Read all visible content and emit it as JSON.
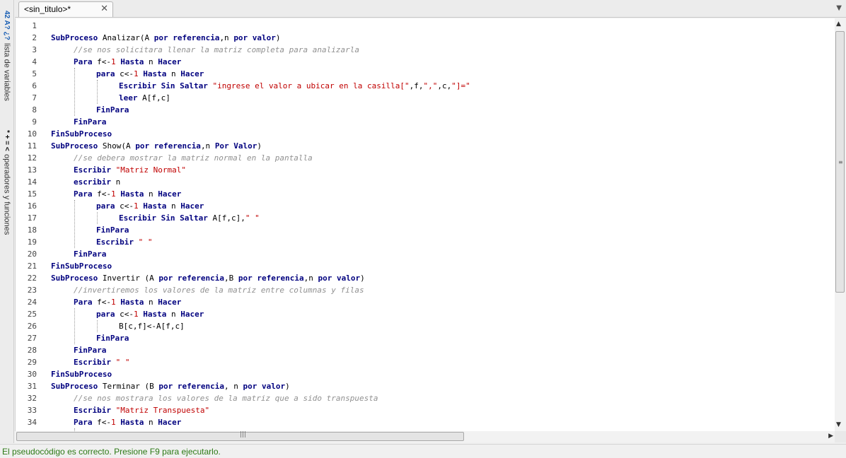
{
  "side_panel": {
    "variables_icon": "42 A? ¿?",
    "variables_label": "lista de variables",
    "operators_icon": "* + = <",
    "operators_label": "operadores y funciones"
  },
  "tabs": [
    {
      "label": "<sin_titulo>*"
    }
  ],
  "editor": {
    "lines": [
      {
        "n": "1",
        "indent": 0,
        "tokens": []
      },
      {
        "n": "2",
        "indent": 0,
        "tokens": [
          [
            "kw",
            "SubProceso"
          ],
          [
            "t",
            " Analizar(A "
          ],
          [
            "kw",
            "por referencia"
          ],
          [
            "t",
            ",n "
          ],
          [
            "kw",
            "por valor"
          ],
          [
            "t",
            ")"
          ]
        ]
      },
      {
        "n": "3",
        "indent": 1,
        "tokens": [
          [
            "cm",
            "//se nos solicitara llenar la matriz completa para analizarla"
          ]
        ]
      },
      {
        "n": "4",
        "indent": 1,
        "tokens": [
          [
            "kw",
            "Para"
          ],
          [
            "t",
            " f<-"
          ],
          [
            "num",
            "1"
          ],
          [
            "t",
            " "
          ],
          [
            "kw",
            "Hasta"
          ],
          [
            "t",
            " n "
          ],
          [
            "kw",
            "Hacer"
          ]
        ]
      },
      {
        "n": "5",
        "indent": 2,
        "tokens": [
          [
            "kw",
            "para"
          ],
          [
            "t",
            " c<-"
          ],
          [
            "num",
            "1"
          ],
          [
            "t",
            " "
          ],
          [
            "kw",
            "Hasta"
          ],
          [
            "t",
            " n "
          ],
          [
            "kw",
            "Hacer"
          ]
        ]
      },
      {
        "n": "6",
        "indent": 3,
        "tokens": [
          [
            "kw",
            "Escribir Sin Saltar"
          ],
          [
            "t",
            " "
          ],
          [
            "str",
            "\"ingrese el valor a ubicar en la casilla[\""
          ],
          [
            "t",
            ",f,"
          ],
          [
            "str",
            "\",\""
          ],
          [
            "t",
            ",c,"
          ],
          [
            "str",
            "\"]=\""
          ]
        ]
      },
      {
        "n": "7",
        "indent": 3,
        "tokens": [
          [
            "kw",
            "leer"
          ],
          [
            "t",
            " A[f,c]"
          ]
        ]
      },
      {
        "n": "8",
        "indent": 2,
        "tokens": [
          [
            "kw",
            "FinPara"
          ]
        ]
      },
      {
        "n": "9",
        "indent": 1,
        "tokens": [
          [
            "kw",
            "FinPara"
          ]
        ]
      },
      {
        "n": "10",
        "indent": 0,
        "tokens": [
          [
            "kw",
            "FinSubProceso"
          ]
        ]
      },
      {
        "n": "11",
        "indent": 0,
        "tokens": [
          [
            "kw",
            "SubProceso"
          ],
          [
            "t",
            " Show(A "
          ],
          [
            "kw",
            "por referencia"
          ],
          [
            "t",
            ",n "
          ],
          [
            "kw",
            "Por Valor"
          ],
          [
            "t",
            ")"
          ]
        ]
      },
      {
        "n": "12",
        "indent": 1,
        "tokens": [
          [
            "cm",
            "//se debera mostrar la matriz normal en la pantalla"
          ]
        ]
      },
      {
        "n": "13",
        "indent": 1,
        "tokens": [
          [
            "kw",
            "Escribir"
          ],
          [
            "t",
            " "
          ],
          [
            "str",
            "\"Matriz Normal\""
          ]
        ]
      },
      {
        "n": "14",
        "indent": 1,
        "tokens": [
          [
            "kw",
            "escribir"
          ],
          [
            "t",
            " n"
          ]
        ]
      },
      {
        "n": "15",
        "indent": 1,
        "tokens": [
          [
            "kw",
            "Para"
          ],
          [
            "t",
            " f<-"
          ],
          [
            "num",
            "1"
          ],
          [
            "t",
            " "
          ],
          [
            "kw",
            "Hasta"
          ],
          [
            "t",
            " n "
          ],
          [
            "kw",
            "Hacer"
          ]
        ]
      },
      {
        "n": "16",
        "indent": 2,
        "tokens": [
          [
            "kw",
            "para"
          ],
          [
            "t",
            " c<-"
          ],
          [
            "num",
            "1"
          ],
          [
            "t",
            " "
          ],
          [
            "kw",
            "Hasta"
          ],
          [
            "t",
            " n "
          ],
          [
            "kw",
            "Hacer"
          ]
        ]
      },
      {
        "n": "17",
        "indent": 3,
        "tokens": [
          [
            "kw",
            "Escribir Sin Saltar"
          ],
          [
            "t",
            " A[f,c],"
          ],
          [
            "str",
            "\" \""
          ]
        ]
      },
      {
        "n": "18",
        "indent": 2,
        "tokens": [
          [
            "kw",
            "FinPara"
          ]
        ]
      },
      {
        "n": "19",
        "indent": 2,
        "tokens": [
          [
            "kw",
            "Escribir"
          ],
          [
            "t",
            " "
          ],
          [
            "str",
            "\" \""
          ]
        ]
      },
      {
        "n": "20",
        "indent": 1,
        "tokens": [
          [
            "kw",
            "FinPara"
          ]
        ]
      },
      {
        "n": "21",
        "indent": 0,
        "tokens": [
          [
            "kw",
            "FinSubProceso"
          ]
        ]
      },
      {
        "n": "22",
        "indent": 0,
        "tokens": [
          [
            "kw",
            "SubProceso"
          ],
          [
            "t",
            " Invertir (A "
          ],
          [
            "kw",
            "por referencia"
          ],
          [
            "t",
            ",B "
          ],
          [
            "kw",
            "por referencia"
          ],
          [
            "t",
            ",n "
          ],
          [
            "kw",
            "por valor"
          ],
          [
            "t",
            ")"
          ]
        ]
      },
      {
        "n": "23",
        "indent": 1,
        "tokens": [
          [
            "cm",
            "//invertiremos los valores de la matriz entre columnas y filas"
          ]
        ]
      },
      {
        "n": "24",
        "indent": 1,
        "tokens": [
          [
            "kw",
            "Para"
          ],
          [
            "t",
            " f<-"
          ],
          [
            "num",
            "1"
          ],
          [
            "t",
            " "
          ],
          [
            "kw",
            "Hasta"
          ],
          [
            "t",
            " n "
          ],
          [
            "kw",
            "Hacer"
          ]
        ]
      },
      {
        "n": "25",
        "indent": 2,
        "tokens": [
          [
            "kw",
            "para"
          ],
          [
            "t",
            " c<-"
          ],
          [
            "num",
            "1"
          ],
          [
            "t",
            " "
          ],
          [
            "kw",
            "Hasta"
          ],
          [
            "t",
            " n "
          ],
          [
            "kw",
            "Hacer"
          ]
        ]
      },
      {
        "n": "26",
        "indent": 3,
        "tokens": [
          [
            "t",
            "B[c,f]<-A[f,c]"
          ]
        ]
      },
      {
        "n": "27",
        "indent": 2,
        "tokens": [
          [
            "kw",
            "FinPara"
          ]
        ]
      },
      {
        "n": "28",
        "indent": 1,
        "tokens": [
          [
            "kw",
            "FinPara"
          ]
        ]
      },
      {
        "n": "29",
        "indent": 1,
        "tokens": [
          [
            "kw",
            "Escribir"
          ],
          [
            "t",
            " "
          ],
          [
            "str",
            "\" \""
          ]
        ]
      },
      {
        "n": "30",
        "indent": 0,
        "tokens": [
          [
            "kw",
            "FinSubProceso"
          ]
        ]
      },
      {
        "n": "31",
        "indent": 0,
        "tokens": [
          [
            "kw",
            "SubProceso"
          ],
          [
            "t",
            " Terminar (B "
          ],
          [
            "kw",
            "por referencia"
          ],
          [
            "t",
            ", n "
          ],
          [
            "kw",
            "por valor"
          ],
          [
            "t",
            ")"
          ]
        ]
      },
      {
        "n": "32",
        "indent": 1,
        "tokens": [
          [
            "cm",
            "//se nos mostrara los valores de la matriz que a sido transpuesta"
          ]
        ]
      },
      {
        "n": "33",
        "indent": 1,
        "tokens": [
          [
            "kw",
            "Escribir"
          ],
          [
            "t",
            " "
          ],
          [
            "str",
            "\"Matriz Transpuesta\""
          ]
        ]
      },
      {
        "n": "34",
        "indent": 1,
        "tokens": [
          [
            "kw",
            "Para"
          ],
          [
            "t",
            " f<-"
          ],
          [
            "num",
            "1"
          ],
          [
            "t",
            " "
          ],
          [
            "kw",
            "Hasta"
          ],
          [
            "t",
            " n "
          ],
          [
            "kw",
            "Hacer"
          ]
        ]
      }
    ]
  },
  "status": {
    "message": "El pseudocódigo es correcto. Presione F9 para ejecutarlo."
  },
  "colors": {
    "keyword": "#00007f",
    "string": "#c00000",
    "comment": "#909090",
    "status_text": "#2d7a16"
  }
}
